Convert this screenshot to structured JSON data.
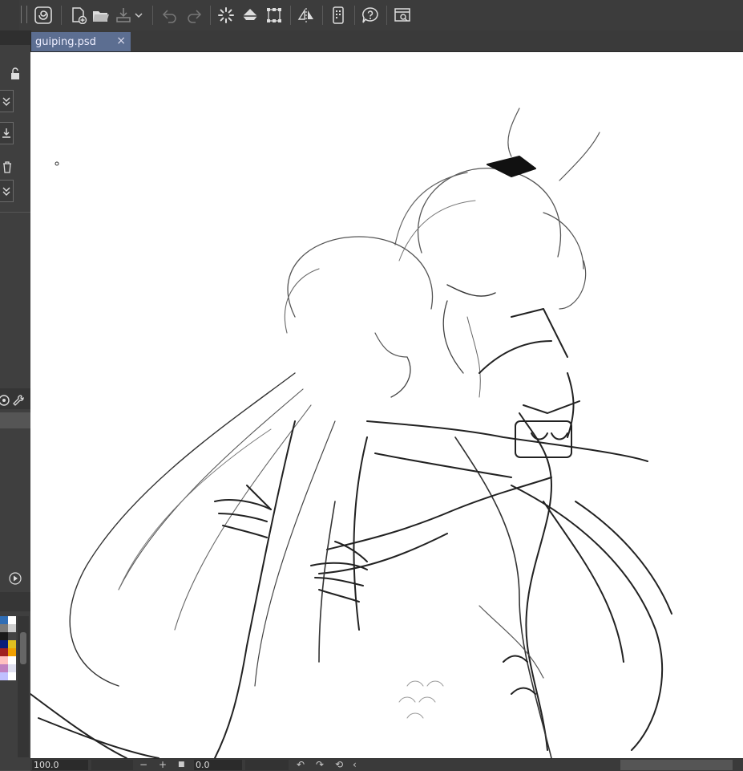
{
  "document": {
    "tab_label": "guiping.psd",
    "close_symbol": "×"
  },
  "toolbar": {
    "icons": [
      "app-logo-icon",
      "new-file-icon",
      "open-file-icon",
      "save-icon",
      "dropdown-arrow-icon",
      "undo-icon",
      "redo-icon",
      "loading-icon",
      "fill-icon",
      "transform-icon",
      "flip-horizontal-icon",
      "device-icon",
      "help-icon",
      "screenshot-icon"
    ]
  },
  "statusbar": {
    "zoom_value": "100.0",
    "zoom_out": "−",
    "zoom_in": "+",
    "fit_symbol": "■",
    "rotation_value": "0.0",
    "back_symbol": "‹"
  },
  "colors": {
    "tab_active": "#5c6e91",
    "ui_dark": "#3c3c3c",
    "canvas": "#ffffff"
  },
  "palette": {
    "swatches": [
      "#2f6db5",
      "#ffffff",
      "#7a7a7a",
      "#cfcfcf",
      "#1a1a1a",
      "#444444",
      "#0a1e7a",
      "#e0c020",
      "#a02020",
      "#f0a000",
      "#ffc0c0",
      "#ffffff",
      "#c080c0",
      "#e0e0f0",
      "#c0c0ff",
      "#ffffff"
    ]
  }
}
